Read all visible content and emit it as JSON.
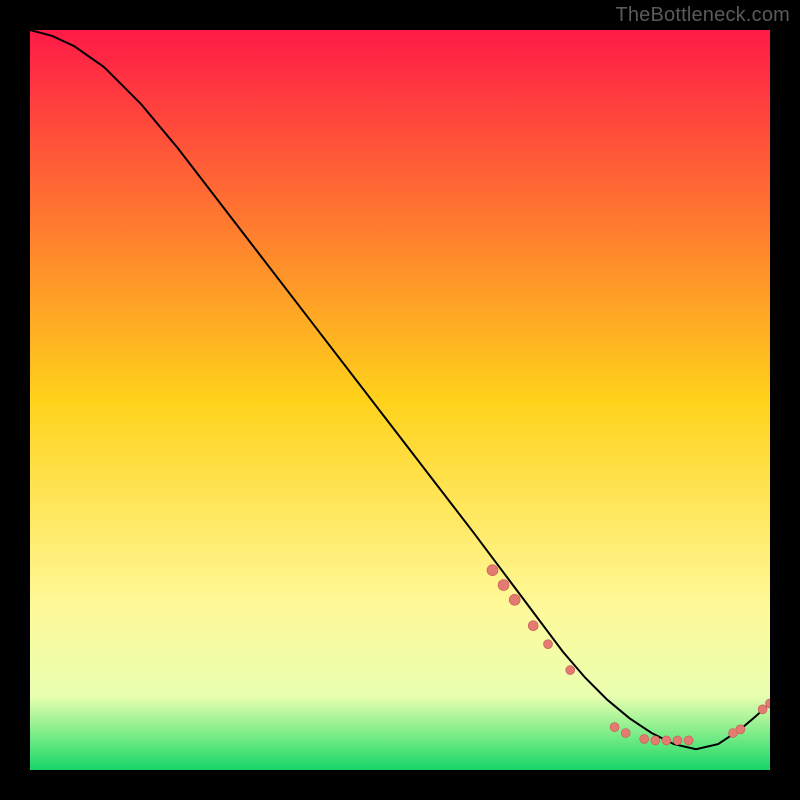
{
  "watermark": "TheBottleneck.com",
  "chart_data": {
    "type": "line",
    "title": "",
    "xlabel": "",
    "ylabel": "",
    "xlim": [
      0,
      100
    ],
    "ylim": [
      0,
      100
    ],
    "background_gradient": {
      "stops": [
        {
          "offset": 0.0,
          "color": "#ff1a47"
        },
        {
          "offset": 0.5,
          "color": "#ffd21a"
        },
        {
          "offset": 0.78,
          "color": "#fff99a"
        },
        {
          "offset": 0.9,
          "color": "#e9ffb0"
        },
        {
          "offset": 0.97,
          "color": "#55e57a"
        },
        {
          "offset": 1.0,
          "color": "#17d46a"
        }
      ]
    },
    "curve": {
      "x": [
        0,
        3,
        6,
        10,
        15,
        20,
        25,
        30,
        35,
        40,
        45,
        50,
        55,
        60,
        63,
        66,
        69,
        72,
        75,
        78,
        81,
        84,
        87,
        90,
        93,
        96,
        98,
        100
      ],
      "y": [
        100,
        99.2,
        97.8,
        95,
        90,
        84,
        77.5,
        71,
        64.5,
        58,
        51.5,
        45,
        38.5,
        32,
        28,
        24,
        20,
        16,
        12.5,
        9.5,
        7,
        5,
        3.5,
        2.8,
        3.5,
        5.5,
        7.2,
        9
      ]
    },
    "markers": [
      {
        "x": 62.5,
        "y": 27,
        "r": 5.5
      },
      {
        "x": 64.0,
        "y": 25,
        "r": 5.5
      },
      {
        "x": 65.5,
        "y": 23,
        "r": 5.5
      },
      {
        "x": 68.0,
        "y": 19.5,
        "r": 5.0
      },
      {
        "x": 70.0,
        "y": 17,
        "r": 4.5
      },
      {
        "x": 73.0,
        "y": 13.5,
        "r": 4.5
      },
      {
        "x": 79.0,
        "y": 5.8,
        "r": 4.5
      },
      {
        "x": 80.5,
        "y": 5.0,
        "r": 4.5
      },
      {
        "x": 83.0,
        "y": 4.2,
        "r": 4.5
      },
      {
        "x": 84.5,
        "y": 4.0,
        "r": 4.5
      },
      {
        "x": 86.0,
        "y": 4.0,
        "r": 4.5
      },
      {
        "x": 87.5,
        "y": 4.0,
        "r": 4.5
      },
      {
        "x": 89.0,
        "y": 4.0,
        "r": 4.5
      },
      {
        "x": 95.0,
        "y": 5.0,
        "r": 4.5
      },
      {
        "x": 96.0,
        "y": 5.5,
        "r": 4.5
      },
      {
        "x": 99.0,
        "y": 8.2,
        "r": 4.5
      },
      {
        "x": 100.0,
        "y": 9.0,
        "r": 4.5
      }
    ],
    "marker_fill": "#e37b72",
    "marker_stroke": "#c75a52",
    "curve_stroke": "#000000"
  }
}
